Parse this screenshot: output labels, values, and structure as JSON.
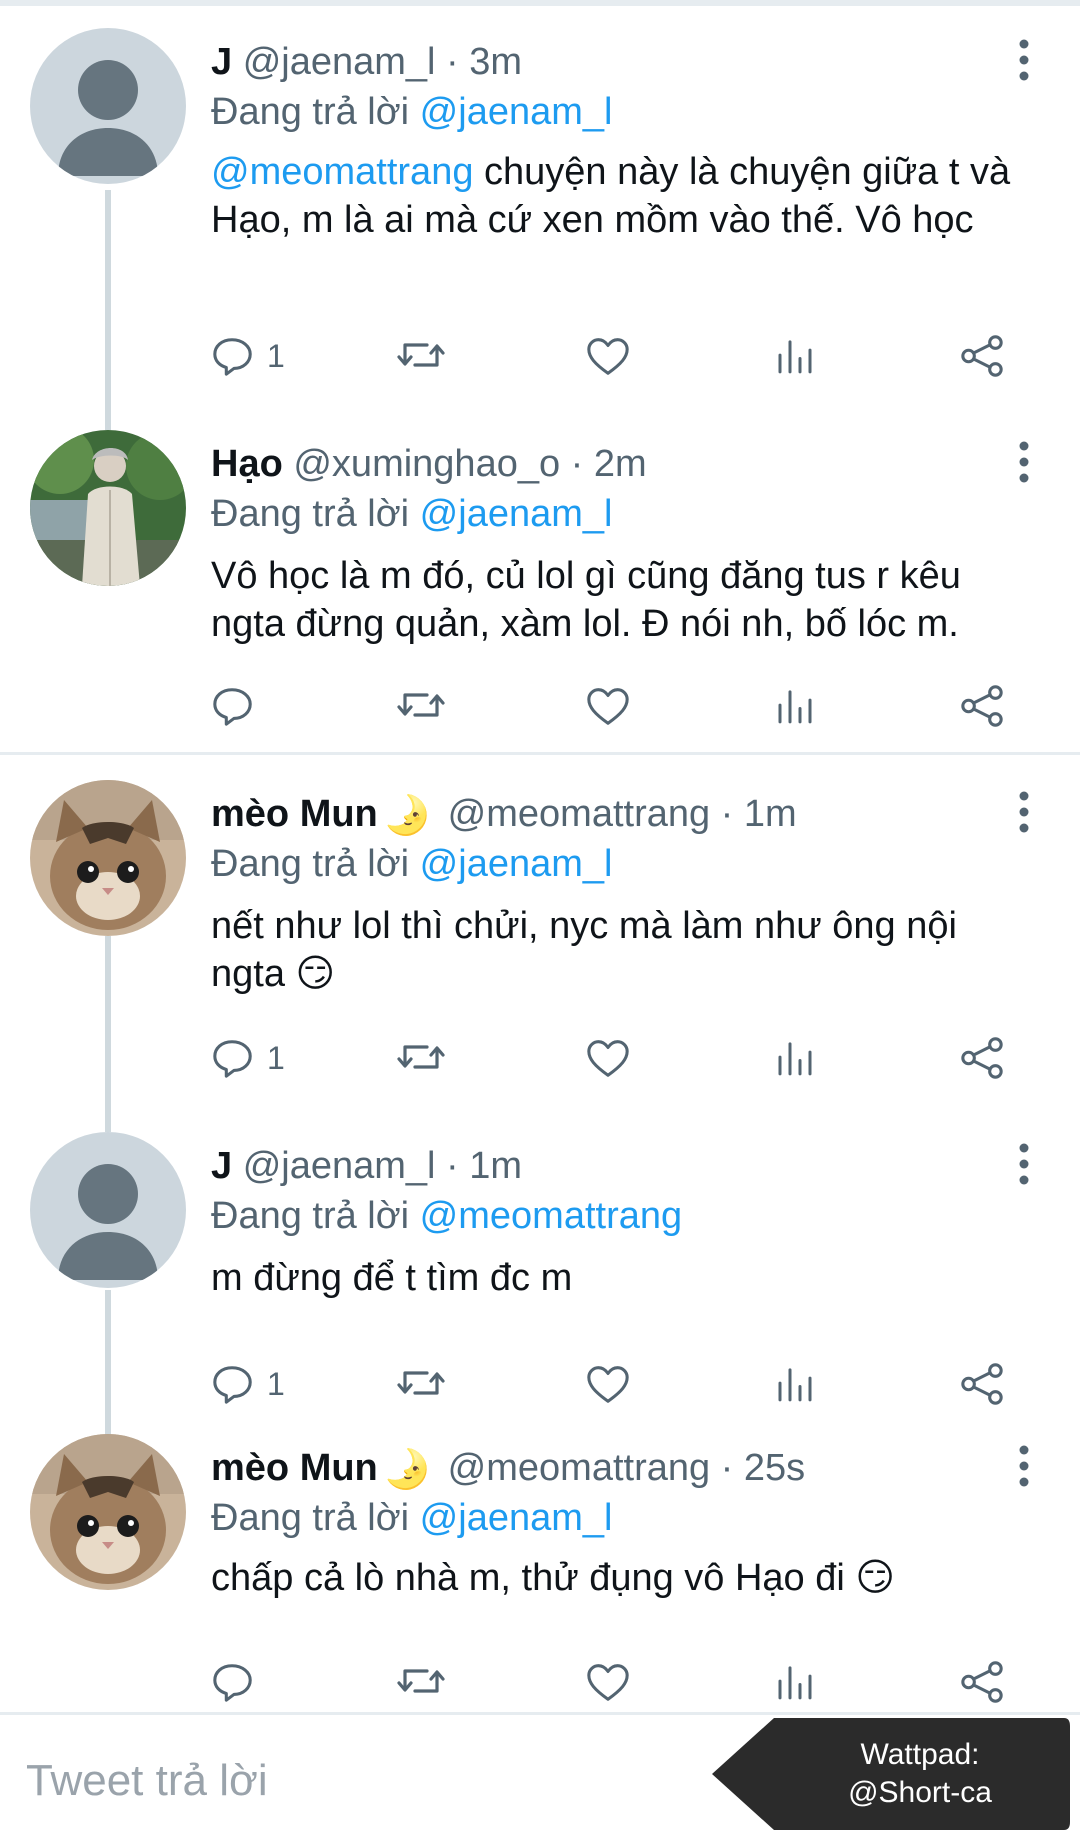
{
  "tweets": [
    {
      "name": "J",
      "handle": "@jaenam_l · 3m",
      "reply_prefix": "Đang trả lời ",
      "reply_to": "@jaenam_l",
      "mention": "@meomattrang",
      "text": " chuyện này là chuyện giữa t và Hạo, m là ai mà cứ xen mồm vào thế. Vô học",
      "reply_count": "1",
      "avatar": "default-avatar"
    },
    {
      "name": "Hạo",
      "handle": "@xuminghao_o · 2m",
      "reply_prefix": "Đang trả lời ",
      "reply_to": "@jaenam_l",
      "text": "Vô học là m đó, củ lol gì cũng đăng tus r kêu ngta đừng quản, xàm lol. Đ nói nh, bố lóc m.",
      "reply_count": "",
      "avatar": "photo-person"
    },
    {
      "name": "mèo Mun",
      "moon": "🌛",
      "handle": "@meomattrang · 1m",
      "reply_prefix": "Đang trả lời ",
      "reply_to": "@jaenam_l",
      "text": "nết như lol thì chửi, nyc mà làm như ông nội ngta 😏",
      "reply_count": "1",
      "avatar": "kitten"
    },
    {
      "name": "J",
      "handle": "@jaenam_l · 1m",
      "reply_prefix": "Đang trả lời ",
      "reply_to": "@meomattrang",
      "text": "m đừng để t tìm đc m",
      "reply_count": "1",
      "avatar": "default-avatar"
    },
    {
      "name": "mèo Mun",
      "moon": "🌛",
      "handle": "@meomattrang · 25s",
      "reply_prefix": "Đang trả lời ",
      "reply_to": "@jaenam_l",
      "text": "chấp cả lò nhà m, thử đụng vô Hạo đi 😏",
      "reply_count": "",
      "avatar": "kitten"
    }
  ],
  "reply_box": {
    "placeholder": "Tweet trả lời"
  },
  "watermark": {
    "line1": "Wattpad:",
    "line2": "@Short-ca"
  },
  "colors": {
    "link": "#1d9bf0",
    "secondary": "#536471",
    "divider": "#e6ecf0",
    "thread": "#cfd9de"
  }
}
